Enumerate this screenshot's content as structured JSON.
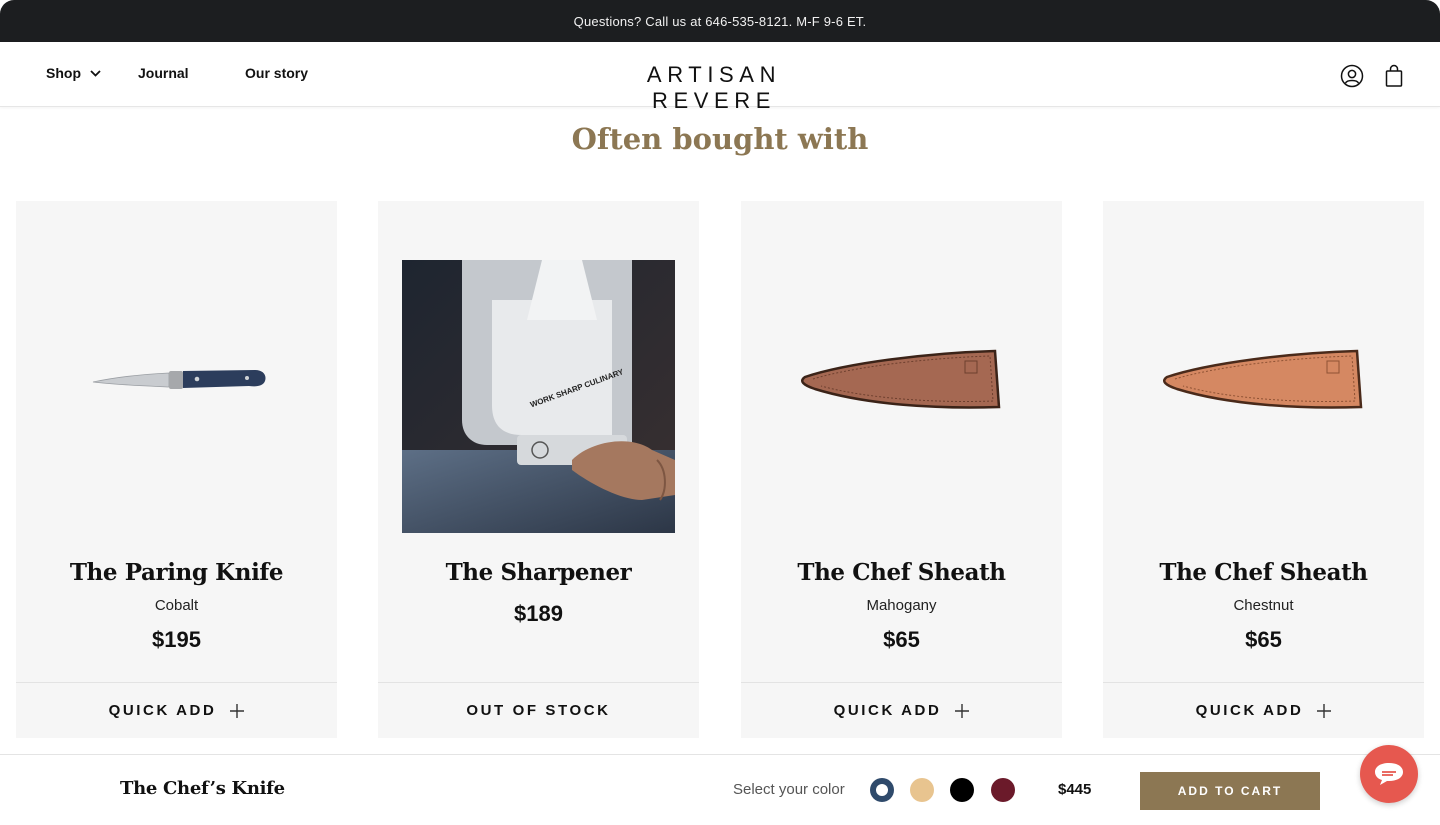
{
  "announcement": {
    "text": "Questions? Call us at 646-535-8121. M-F 9-6 ET."
  },
  "header": {
    "nav": {
      "shop": "Shop",
      "journal": "Journal",
      "story": "Our story"
    },
    "logo": "ARTISAN REVERE",
    "icons": [
      "account-icon",
      "bag-icon"
    ]
  },
  "section": {
    "title": "Often bought with"
  },
  "products": [
    {
      "name": "The Paring Knife",
      "variant": "Cobalt",
      "price": "$195",
      "action": "QUICK ADD"
    },
    {
      "name": "The Sharpener",
      "variant": "",
      "price": "$189",
      "action": "OUT OF STOCK",
      "brand_mark": "WORK SHARP CULINARY"
    },
    {
      "name": "The Chef Sheath",
      "variant": "Mahogany",
      "price": "$65",
      "action": "QUICK ADD"
    },
    {
      "name": "The Chef Sheath",
      "variant": "Chestnut",
      "price": "$65",
      "action": "QUICK ADD"
    }
  ],
  "sticky_bar": {
    "product_name": "The Chef’s Knife",
    "select_label": "Select your color",
    "swatches": [
      {
        "name": "blue",
        "color": "#2f4a6b",
        "selected": true
      },
      {
        "name": "tan",
        "color": "#e8c48f",
        "selected": false
      },
      {
        "name": "black",
        "color": "#000000",
        "selected": false
      },
      {
        "name": "burgundy",
        "color": "#6b1a2a",
        "selected": false
      }
    ],
    "price": "$445",
    "add_to_cart": "ADD TO CART"
  },
  "colors": {
    "accent": "#8c7753",
    "announce_bg": "#1c1e20",
    "card_bg": "#f6f6f6",
    "chat": "#e6584f"
  }
}
